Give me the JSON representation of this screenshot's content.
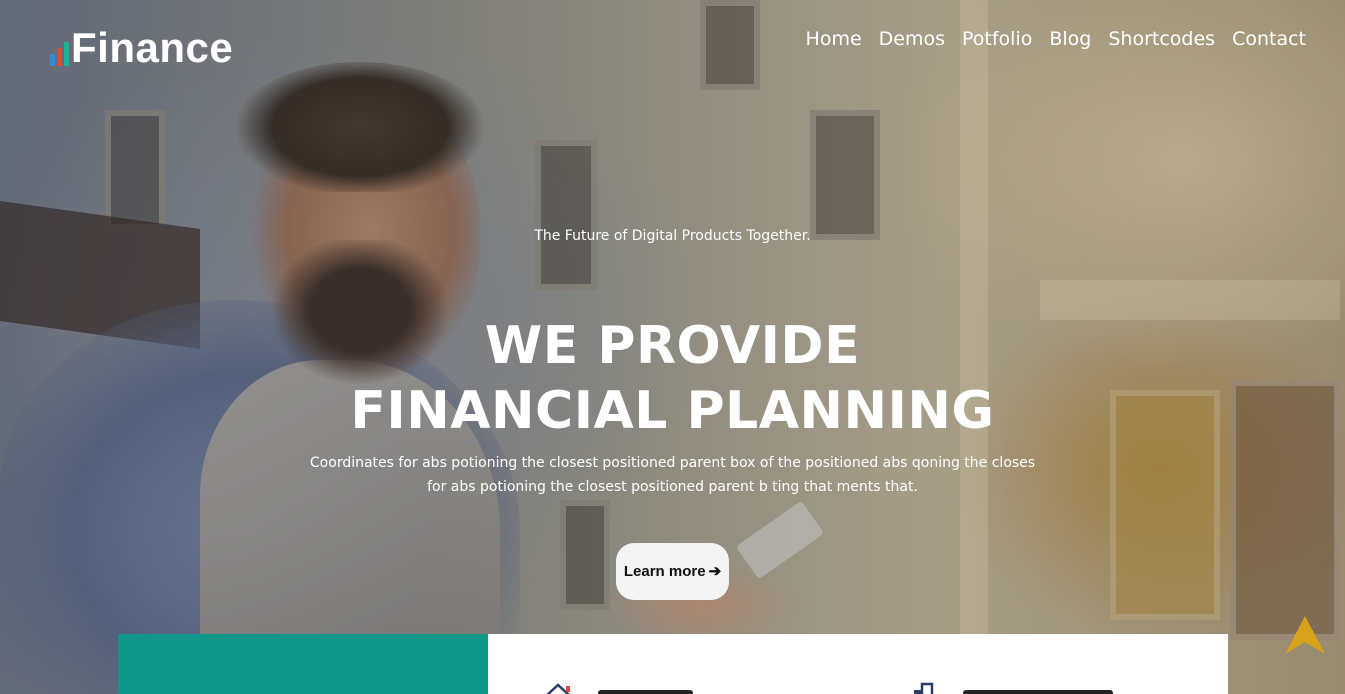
{
  "brand": {
    "name": "Finance",
    "colors": {
      "bar1": "#2a8de0",
      "bar2": "#e8463b",
      "bar3": "#1ab394"
    }
  },
  "nav": {
    "items": [
      {
        "label": "Home"
      },
      {
        "label": "Demos"
      },
      {
        "label": "Potfolio"
      },
      {
        "label": "Blog"
      },
      {
        "label": "Shortcodes"
      },
      {
        "label": "Contact"
      }
    ]
  },
  "hero": {
    "tagline": "The Future of Digital Products Together.",
    "headline_line1": "WE PROVIDE",
    "headline_line2": "FINANCIAL PLANNING",
    "description_line1": "Coordinates for abs potioning the closest positioned parent box of the positioned abs qoning the closes",
    "description_line2": "for abs potioning the closest positioned parent b ting that ments that.",
    "cta_label": "Learn more",
    "cta_icon": "arrow-right-icon"
  },
  "features": {
    "teal_panel_color": "#0f9887",
    "icons": [
      "house-icon",
      "building-icon"
    ]
  },
  "scroll_top": {
    "icon": "chevron-up-icon",
    "color": "#d9a21b"
  }
}
